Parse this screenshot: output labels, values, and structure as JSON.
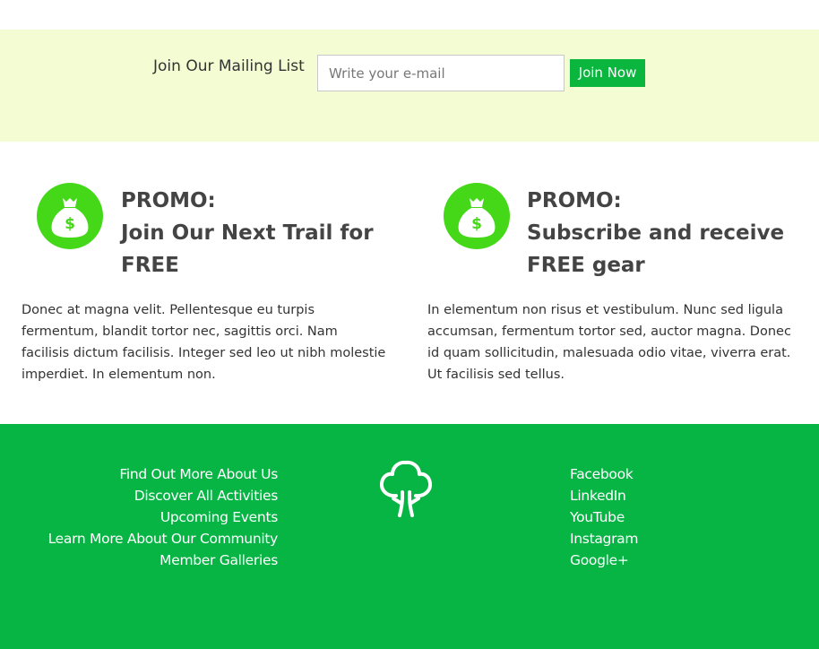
{
  "mailing": {
    "label": "Join Our Mailing List",
    "email_placeholder": "Write your e-mail",
    "button_label": "Join Now"
  },
  "promos": [
    {
      "icon": "money-bag-icon",
      "title_line1": "PROMO:",
      "title_line2": "Join Our Next Trail for",
      "title_line3": "FREE",
      "text": "Donec at magna velit. Pellentesque eu turpis fermentum, blandit tortor nec, sagittis orci. Nam facilisis dictum facilisis. Integer sed leo ut nibh molestie imperdiet. In elementum non."
    },
    {
      "icon": "money-bag-icon",
      "title_line1": "PROMO:",
      "title_line2": "Subscribe and receive",
      "title_line3": "FREE gear",
      "text": "In elementum non risus et vestibulum. Nunc sed ligula accumsan, fermentum tortor sed, auctor magna. Donec id quam sollicitudin, malesuada odio vitae, viverra erat. Ut facilisis sed tellus."
    }
  ],
  "footer": {
    "links_left": [
      "Find Out More About Us",
      "Discover All Activities",
      "Upcoming Events",
      "Learn More About Our Community",
      "Member Galleries"
    ],
    "logo_icon": "tree-icon",
    "links_right": [
      "Facebook",
      "LinkedIn",
      "YouTube",
      "Instagram",
      "Google+"
    ]
  },
  "colors": {
    "mailing_bg": "#f3fcd2",
    "accent_green": "#0bb63f",
    "icon_green": "#44d819",
    "footer_bg": "#06b544",
    "heading_text": "#444444"
  }
}
